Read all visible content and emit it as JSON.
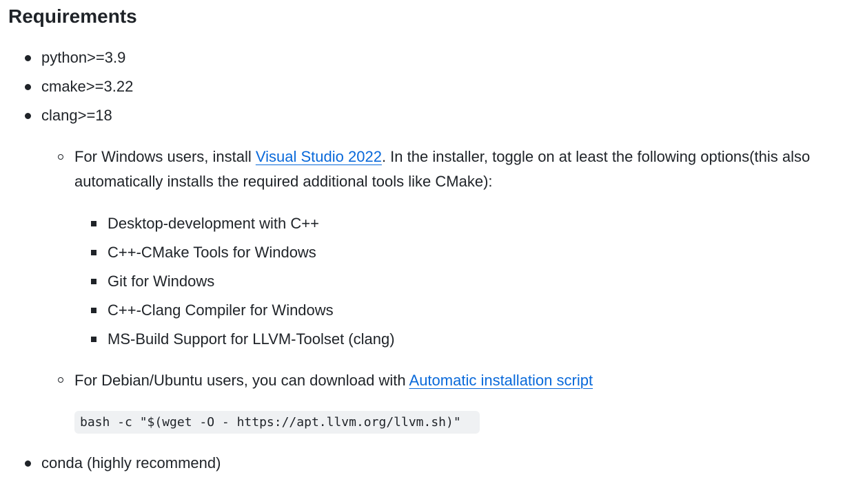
{
  "heading": "Requirements",
  "top_list": [
    {
      "text": "python>=3.9"
    },
    {
      "text": "cmake>=3.22"
    },
    {
      "text": "clang>=18"
    },
    {
      "text": "conda (highly recommend)"
    }
  ],
  "windows": {
    "prefix": "For Windows users, install ",
    "link": "Visual Studio 2022",
    "suffix": ". In the installer, toggle on at least the following options(this also automatically installs the required additional tools like CMake):",
    "options": [
      "Desktop-development with C++",
      "C++-CMake Tools for Windows",
      "Git for Windows",
      "C++-Clang Compiler for Windows",
      "MS-Build Support for LLVM-Toolset (clang)"
    ]
  },
  "debian": {
    "prefix": "For Debian/Ubuntu users, you can download with ",
    "link": "Automatic installation script",
    "code": "bash -c \"$(wget -O - https://apt.llvm.org/llvm.sh)\""
  },
  "colors": {
    "text": "#1f2328",
    "link": "#0969da",
    "code_background": "#eff1f3"
  }
}
